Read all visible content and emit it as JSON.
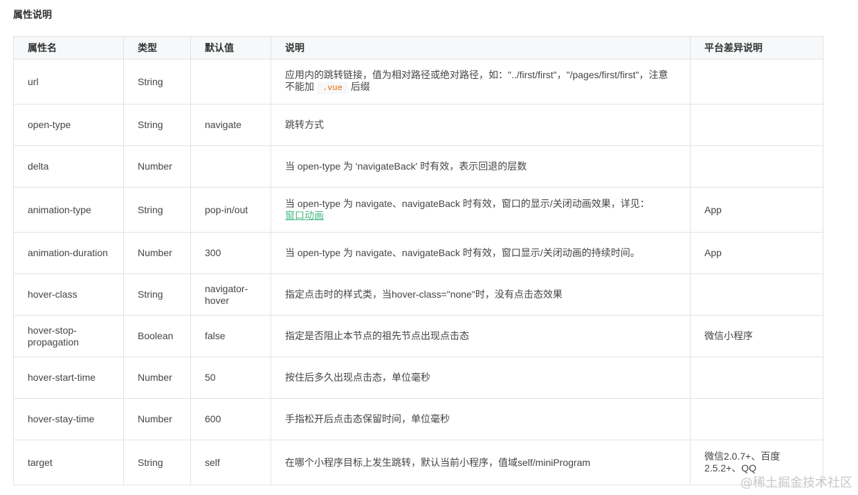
{
  "section_title": "属性说明",
  "table": {
    "headers": [
      "属性名",
      "类型",
      "默认值",
      "说明",
      "平台差异说明"
    ],
    "rows": [
      {
        "name": "url",
        "type": "String",
        "default": "",
        "desc_pre": "应用内的跳转链接，值为相对路径或绝对路径，如：\"../first/first\"，\"/pages/first/first\"，注意不能加",
        "desc_code": ".vue",
        "desc_post": "后缀",
        "platform": ""
      },
      {
        "name": "open-type",
        "type": "String",
        "default": "navigate",
        "desc": "跳转方式",
        "platform": ""
      },
      {
        "name": "delta",
        "type": "Number",
        "default": "",
        "desc": "当 open-type 为 'navigateBack' 时有效，表示回退的层数",
        "platform": ""
      },
      {
        "name": "animation-type",
        "type": "String",
        "default": "pop-in/out",
        "desc_pre": "当 open-type 为 navigate、navigateBack 时有效，窗口的显示/关闭动画效果，详见：",
        "desc_link": "窗口动画",
        "platform": "App"
      },
      {
        "name": "animation-duration",
        "type": "Number",
        "default": "300",
        "desc": "当 open-type 为 navigate、navigateBack 时有效，窗口显示/关闭动画的持续时间。",
        "platform": "App"
      },
      {
        "name": "hover-class",
        "type": "String",
        "default": "navigator-hover",
        "desc": "指定点击时的样式类，当hover-class=\"none\"时，没有点击态效果",
        "platform": ""
      },
      {
        "name": "hover-stop-propagation",
        "type": "Boolean",
        "default": "false",
        "desc": "指定是否阻止本节点的祖先节点出现点击态",
        "platform": "微信小程序"
      },
      {
        "name": "hover-start-time",
        "type": "Number",
        "default": "50",
        "desc": "按住后多久出现点击态，单位毫秒",
        "platform": ""
      },
      {
        "name": "hover-stay-time",
        "type": "Number",
        "default": "600",
        "desc": "手指松开后点击态保留时间，单位毫秒",
        "platform": ""
      },
      {
        "name": "target",
        "type": "String",
        "default": "self",
        "desc": "在哪个小程序目标上发生跳转，默认当前小程序，值域self/miniProgram",
        "platform": "微信2.0.7+、百度2.5.2+、QQ"
      }
    ]
  },
  "watermark": "@稀土掘金技术社区",
  "colors": {
    "header_bg": "#f6f8fa",
    "border": "#dfe2e5",
    "link": "#42b983",
    "code": "#e96900"
  }
}
